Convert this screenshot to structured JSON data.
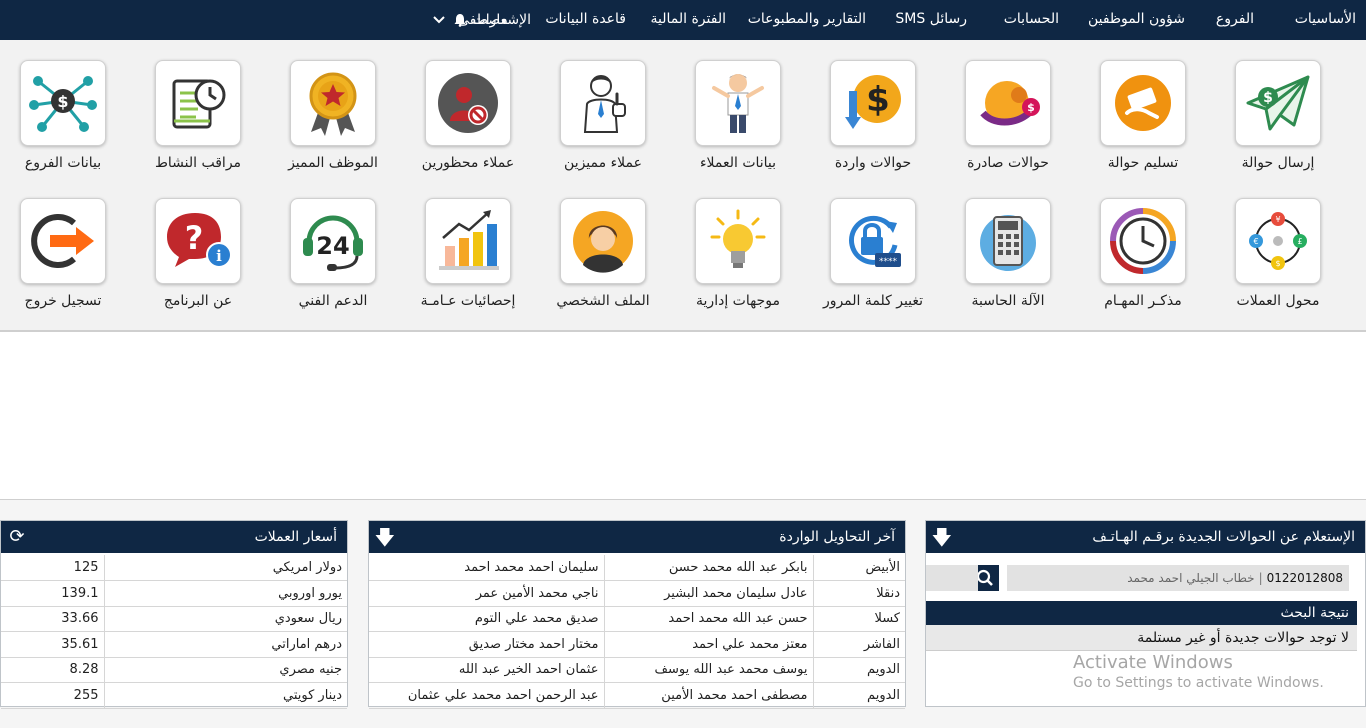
{
  "nav": {
    "items": [
      "الأساسيات",
      "الفروع",
      "شؤون الموظفين",
      "الحسابات",
      "رسائل SMS",
      "التقارير والمطبوعات",
      "الفترة المالية",
      "قاعدة البيانات",
      "الإشعارات",
      "مصطفى"
    ]
  },
  "tiles": {
    "row1": [
      "إرسال حوالة",
      "تسليم حوالة",
      "حوالات صادرة",
      "حوالات واردة",
      "بيانات العملاء",
      "عملاء مميزين",
      "عملاء محظورين",
      "الموظف المميز",
      "مراقب النشاط",
      "بيانات الفروع"
    ],
    "row2": [
      "محول العملات",
      "مذكـر المهـام",
      "الآلة الحاسبة",
      "تغيير كلمة المرور",
      "موجهات إدارية",
      "الملف الشخصي",
      "إحصائيات عـامـة",
      "الدعم الفني",
      "عن البرنامج",
      "تسجيل خروج"
    ],
    "support_badge": "24"
  },
  "inquiry": {
    "title": "الإستعلام عن الحوالات الجديدة برقـم الهـاتـف",
    "phone": "0122012808",
    "separator": "|",
    "name": "خطاب الجيلي احمد محمد",
    "result_title": "نتيجة البحث",
    "result_text": "لا توجد حوالات جديدة أو غير مستلمة"
  },
  "transfers": {
    "title": "آخر التحاويل الواردة",
    "rows": [
      [
        "الأبيض",
        "بابكر عبد الله محمد حسن",
        "سليمان احمد محمد احمد"
      ],
      [
        "دنقلا",
        "عادل سليمان محمد البشير",
        "ناجي محمد الأمين عمر"
      ],
      [
        "كسلا",
        "حسن عبد الله محمد احمد",
        "صديق محمد علي التوم"
      ],
      [
        "الفاشر",
        "معتز محمد علي احمد",
        "مختار احمد مختار صديق"
      ],
      [
        "الدويم",
        "يوسف محمد عبد الله يوسف",
        "عثمان احمد الخير عبد الله"
      ],
      [
        "الدويم",
        "مصطفى احمد محمد الأمين",
        "عبد الرحمن احمد محمد علي عثمان"
      ]
    ]
  },
  "rates": {
    "title": "أسعار العملات",
    "rows": [
      [
        "دولار امريكي",
        "125"
      ],
      [
        "يورو اوروبي",
        "139.1"
      ],
      [
        "ريال سعودي",
        "33.66"
      ],
      [
        "درهم اماراتي",
        "35.61"
      ],
      [
        "جنيه مصري",
        "8.28"
      ],
      [
        "دينار كويتي",
        "255"
      ]
    ]
  },
  "watermark": {
    "line1": "Activate Windows",
    "line2": "Go to Settings to activate Windows."
  },
  "colors": {
    "navy": "#0f2744",
    "panel": "#f2f2f2"
  }
}
